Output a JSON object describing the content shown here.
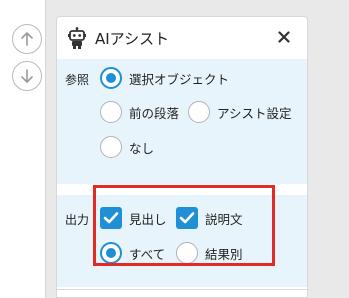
{
  "panel": {
    "title": "AIアシスト",
    "close_icon": "close-icon",
    "robot_icon": "robot-icon"
  },
  "nav": {
    "up_icon": "arrow-up-icon",
    "down_icon": "arrow-down-icon"
  },
  "reference": {
    "label": "参照",
    "options": [
      {
        "label": "選択オブジェクト",
        "selected": true
      },
      {
        "label": "前の段落",
        "selected": false
      },
      {
        "label": "アシスト設定",
        "selected": false
      },
      {
        "label": "なし",
        "selected": false
      }
    ]
  },
  "output": {
    "label": "出力",
    "checkboxes": [
      {
        "label": "見出し",
        "checked": true
      },
      {
        "label": "説明文",
        "checked": true
      }
    ],
    "radios": [
      {
        "label": "すべて",
        "selected": true
      },
      {
        "label": "結果別",
        "selected": false
      }
    ]
  },
  "colors": {
    "accent": "#1f8fd6",
    "section_bg": "#e8f4fb",
    "highlight": "#e32b24"
  }
}
